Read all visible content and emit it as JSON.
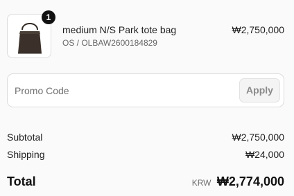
{
  "cart": {
    "item": {
      "quantity": "1",
      "name": "medium N/S Park tote bag",
      "variant": "OS / OLBAW2600184829",
      "price": "₩2,750,000",
      "image_icon": "tote-bag-image"
    }
  },
  "promo": {
    "placeholder": "Promo Code",
    "value": "",
    "apply_label": "Apply"
  },
  "summary": {
    "subtotal_label": "Subtotal",
    "subtotal_value": "₩2,750,000",
    "shipping_label": "Shipping",
    "shipping_value": "₩24,000",
    "total_label": "Total",
    "currency": "KRW",
    "total_value": "₩2,774,000"
  },
  "colors": {
    "background": "#fafafa",
    "text": "#1f1f1f",
    "muted": "#707070",
    "border": "#dcdcdc",
    "badge": "#111111",
    "bag": "#3b312a"
  }
}
